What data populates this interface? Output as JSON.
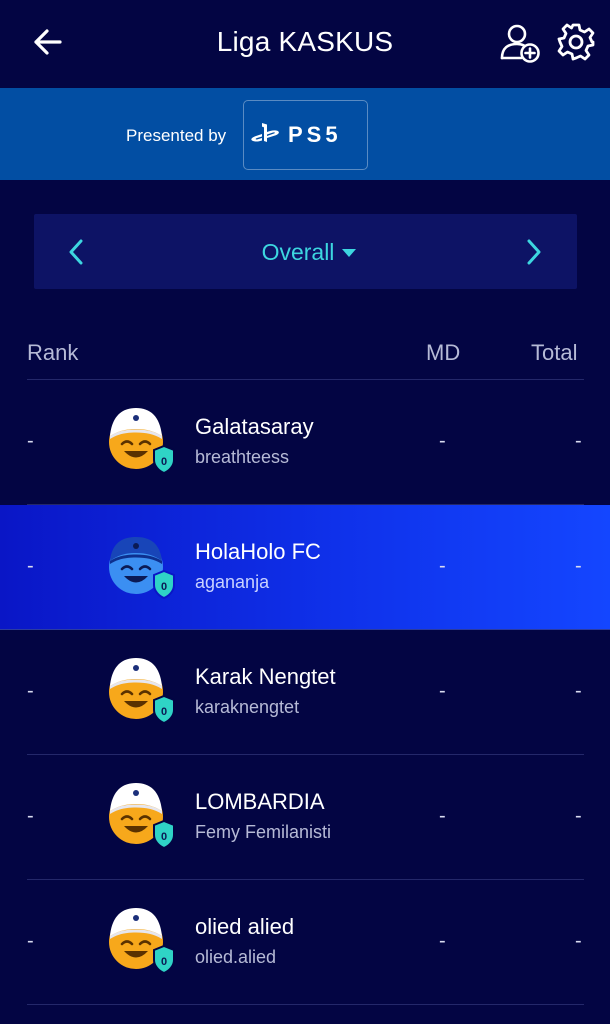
{
  "header": {
    "title": "Liga KASKUS",
    "back_icon": "arrow-left-icon",
    "add_user_icon": "add-user-icon",
    "settings_icon": "gear-icon"
  },
  "sponsor": {
    "label": "Presented by",
    "logo_text": "PS5"
  },
  "selector": {
    "value": "Overall",
    "prev_icon": "chevron-left-icon",
    "next_icon": "chevron-right-icon",
    "accent": "#3dd6e0"
  },
  "table": {
    "columns": {
      "rank": "Rank",
      "md": "MD",
      "total": "Total"
    },
    "rows": [
      {
        "rank": "-",
        "team": "Galatasaray",
        "user": "breathteess",
        "md": "-",
        "total": "-",
        "badge": "0",
        "avatar": "default-yellow",
        "highlight": false
      },
      {
        "rank": "-",
        "team": "HolaHolo FC",
        "user": "agananja",
        "md": "-",
        "total": "-",
        "badge": "0",
        "avatar": "own-blue",
        "highlight": true
      },
      {
        "rank": "-",
        "team": "Karak Nengtet",
        "user": "karaknengtet",
        "md": "-",
        "total": "-",
        "badge": "0",
        "avatar": "default-yellow",
        "highlight": false
      },
      {
        "rank": "-",
        "team": "LOMBARDIA",
        "user": "Femy Femilanisti",
        "md": "-",
        "total": "-",
        "badge": "0",
        "avatar": "default-yellow",
        "highlight": false
      },
      {
        "rank": "-",
        "team": "olied alied",
        "user": "olied.alied",
        "md": "-",
        "total": "-",
        "badge": "0",
        "avatar": "default-yellow",
        "highlight": false
      }
    ]
  },
  "colors": {
    "background": "#030543",
    "sponsor_bar": "#024ea3",
    "selector_bg": "#0d1365",
    "highlight_row": "#0f31ea"
  }
}
